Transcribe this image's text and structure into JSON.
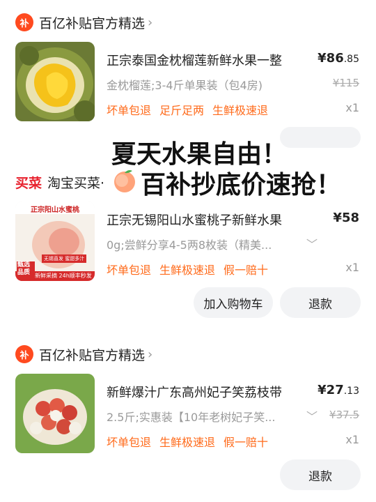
{
  "orders": [
    {
      "store": {
        "logo_text": "补",
        "name": "百亿补贴官方精选",
        "arrow": "›"
      },
      "product": {
        "title": "正宗泰国金枕榴莲新鲜水果一整",
        "price_symbol": "¥",
        "price_int": "86",
        "price_dec": ".85",
        "spec": "金枕榴莲;3-4斤单果装（包4房)",
        "original_price": "¥115",
        "tags": [
          "坏单包退",
          "足斤足两",
          "生鲜极速退"
        ],
        "quantity": "x1"
      }
    },
    {
      "store": {
        "logo_text": "买菜",
        "name": "淘宝买菜·"
      },
      "product": {
        "title": "正宗无锡阳山水蜜桃子新鲜水果",
        "price_symbol": "¥",
        "price_int": "58",
        "price_dec": "",
        "spec": "0g;尝鲜分享4-5两8枚装（精美...",
        "thumb_label_top": "正宗阳山水蜜桃",
        "thumb_badge": "甄选品质",
        "thumb_strip": "新鲜采摘 24h顺丰秒发",
        "thumb_note": "无锡直发 蜜甜多汁",
        "tags": [
          "坏单包退",
          "生鲜极速退",
          "假一赔十"
        ],
        "quantity": "x1"
      },
      "buttons": {
        "add_cart": "加入购物车",
        "refund": "退款"
      }
    },
    {
      "store": {
        "logo_text": "补",
        "name": "百亿补贴官方精选",
        "arrow": "›"
      },
      "product": {
        "title": "新鲜爆汁广东高州妃子笑荔枝带",
        "price_symbol": "¥",
        "price_int": "27",
        "price_dec": ".13",
        "spec": "2.5斤;实惠装【10年老树妃子笑...",
        "original_price": "¥37.5",
        "tags": [
          "坏单包退",
          "生鲜极速退",
          "假一赔十"
        ],
        "quantity": "x1"
      },
      "buttons": {
        "refund": "退款"
      }
    }
  ],
  "overlay": {
    "line1": "夏天水果自由！",
    "line2": "百补抄底价速抢！"
  },
  "icons": {
    "chevron": "chevron-down-icon",
    "peach": "peach-emoji-icon"
  },
  "colors": {
    "accent_orange": "#ff6a1a",
    "logo_red": "#ff4a1f",
    "maicai_red": "#e8232f",
    "button_bg": "#f2f3f5"
  }
}
